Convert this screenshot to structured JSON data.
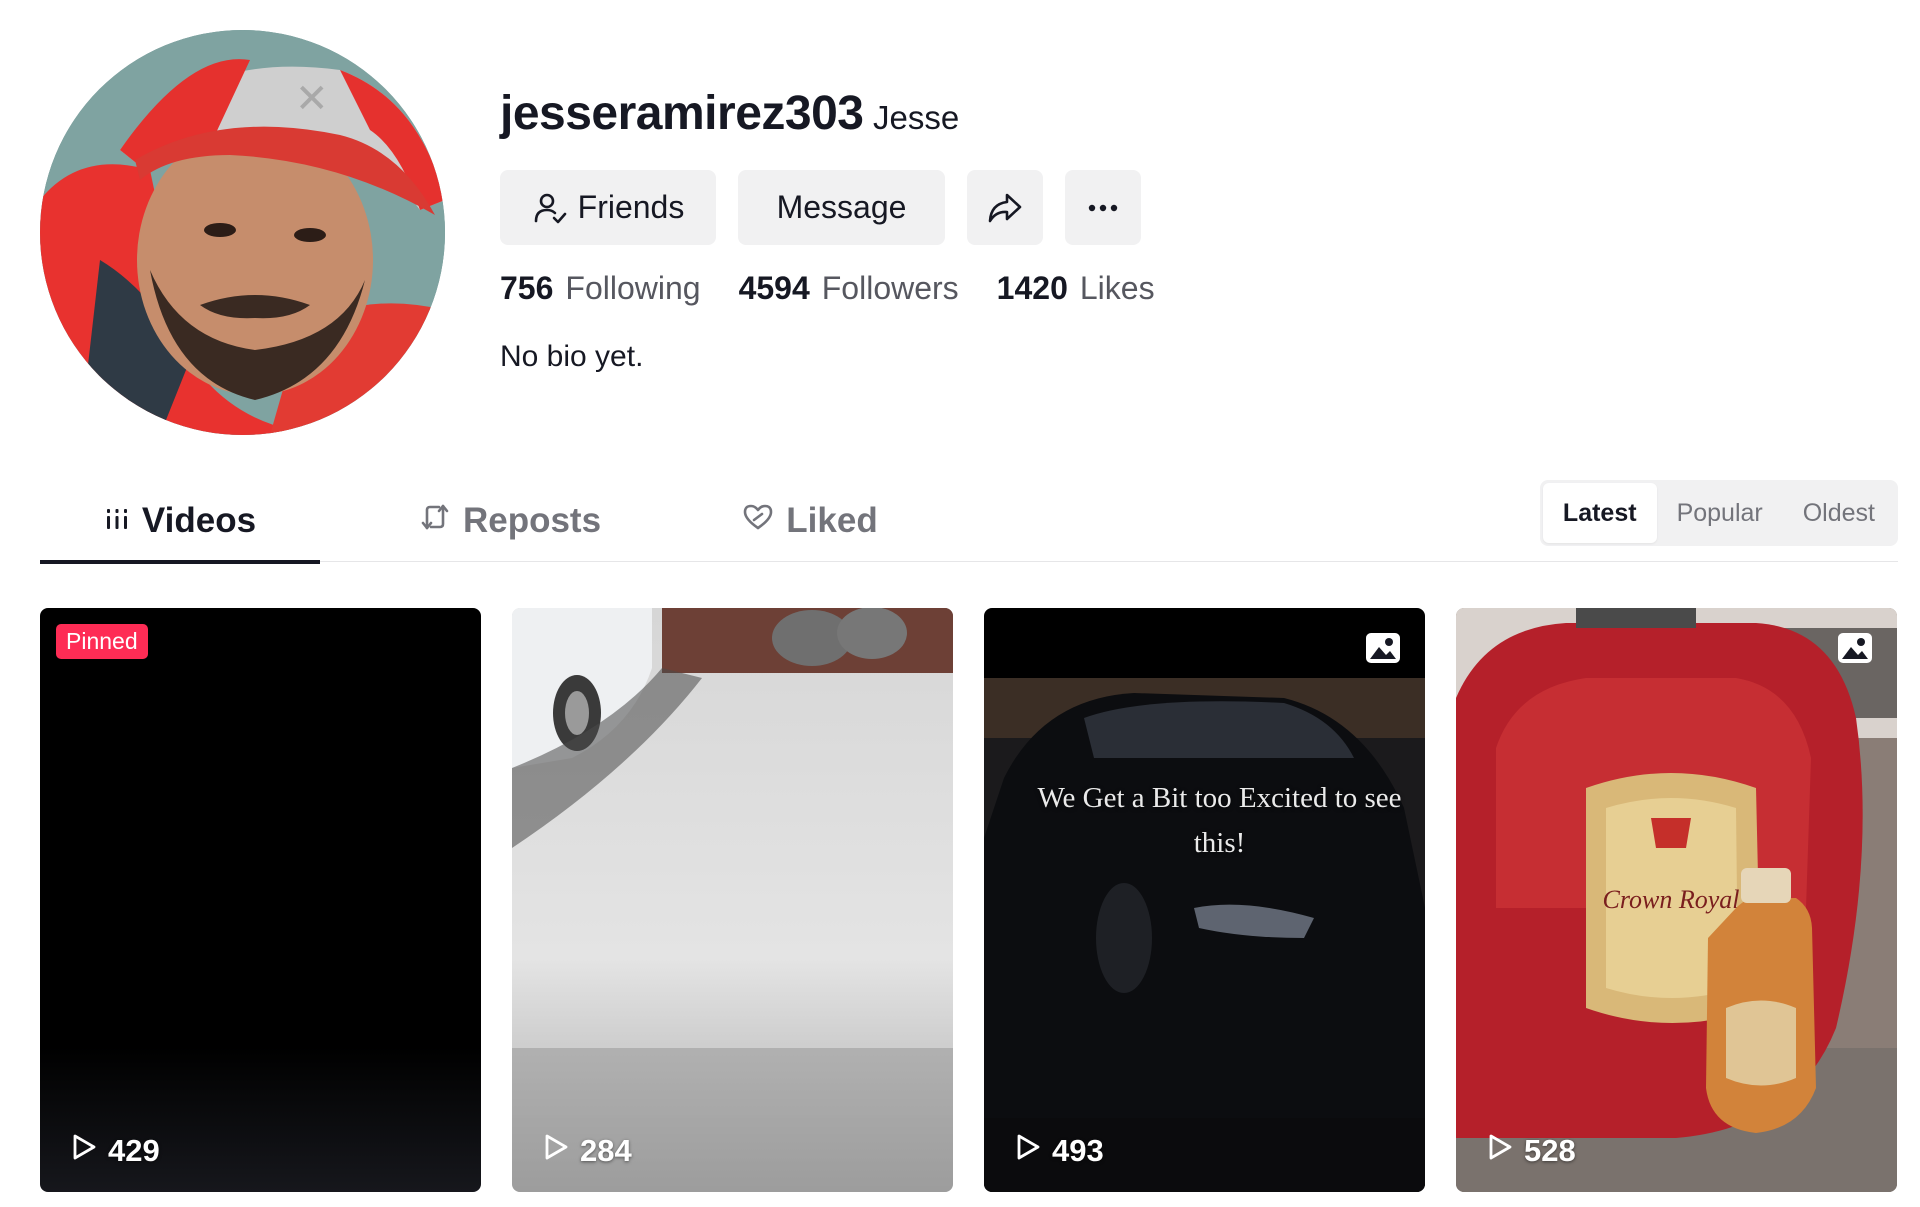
{
  "profile": {
    "username": "jesseramirez303",
    "nickname": "Jesse",
    "bio": "No bio yet."
  },
  "actions": {
    "friends_label": "Friends",
    "message_label": "Message",
    "share_icon": "share-icon",
    "more_icon": "more-icon"
  },
  "stats": [
    {
      "value": "756",
      "label": "Following"
    },
    {
      "value": "4594",
      "label": "Followers"
    },
    {
      "value": "1420",
      "label": "Likes"
    }
  ],
  "tabs": [
    {
      "label": "Videos",
      "icon": "grid-icon",
      "active": true
    },
    {
      "label": "Reposts",
      "icon": "repost-icon",
      "active": false
    },
    {
      "label": "Liked",
      "icon": "heart-icon",
      "active": false
    }
  ],
  "sort": {
    "options": [
      "Latest",
      "Popular",
      "Oldest"
    ],
    "selected": "Latest"
  },
  "videos": [
    {
      "views": "429",
      "badge": "Pinned",
      "thumbnail": "black video frame"
    },
    {
      "views": "284",
      "thumbnail": "snow-covered yard with parked car"
    },
    {
      "views": "493",
      "type": "photo",
      "overlay_text": "We Get a Bit too Excited to see this!",
      "thumbnail": "black car at night"
    },
    {
      "views": "528",
      "type": "photo",
      "thumbnail": "Crown Royal whisky bottles"
    }
  ],
  "colors": {
    "accent": "#fe2c55",
    "text_primary": "#161823",
    "text_secondary": "#73747b",
    "button_bg": "#f1f1f2"
  }
}
